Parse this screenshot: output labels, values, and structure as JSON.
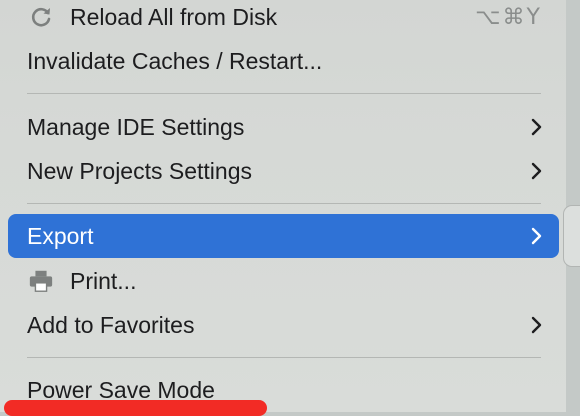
{
  "menu": {
    "items": [
      {
        "label": "Reload All from Disk",
        "icon": "reload-icon",
        "shortcut": "⌥⌘Y"
      },
      {
        "label": "Invalidate Caches / Restart..."
      },
      {
        "label": "Manage IDE Settings",
        "submenu": true
      },
      {
        "label": "New Projects Settings",
        "submenu": true
      },
      {
        "label": "Export",
        "submenu": true,
        "selected": true
      },
      {
        "label": "Print...",
        "icon": "printer-icon"
      },
      {
        "label": "Add to Favorites",
        "submenu": true
      },
      {
        "label": "Power Save Mode"
      }
    ]
  },
  "colors": {
    "selection": "#2f72d6",
    "menu_background": "#d6d9d6",
    "annotation": "#f22b25"
  }
}
